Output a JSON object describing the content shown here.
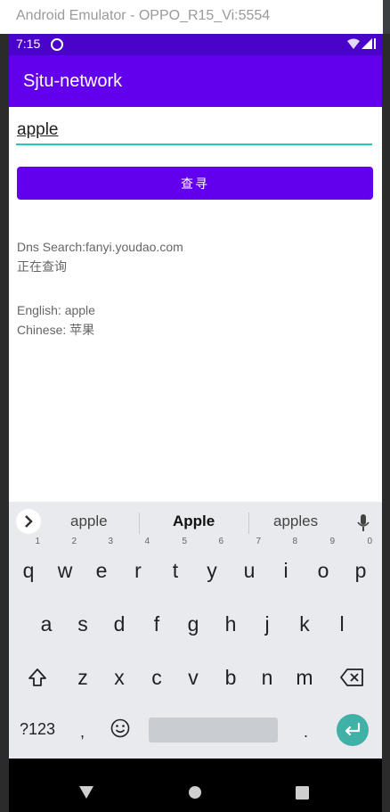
{
  "window": {
    "title": "Android Emulator - OPPO_R15_Vi:5554"
  },
  "status_bar": {
    "time": "7:15"
  },
  "app_bar": {
    "title": "Sjtu-network"
  },
  "search": {
    "value": "apple"
  },
  "query_button": {
    "label": "查寻"
  },
  "result": {
    "dns_line": "Dns Search:fanyi.youdao.com",
    "status_line": "正在查询",
    "english_line": "English: apple",
    "chinese_line": "Chinese: 苹果"
  },
  "keyboard": {
    "suggestions": [
      "apple",
      "Apple",
      "apples"
    ],
    "row1": [
      {
        "key": "q",
        "hint": "1"
      },
      {
        "key": "w",
        "hint": "2"
      },
      {
        "key": "e",
        "hint": "3"
      },
      {
        "key": "r",
        "hint": "4"
      },
      {
        "key": "t",
        "hint": "5"
      },
      {
        "key": "y",
        "hint": "6"
      },
      {
        "key": "u",
        "hint": "7"
      },
      {
        "key": "i",
        "hint": "8"
      },
      {
        "key": "o",
        "hint": "9"
      },
      {
        "key": "p",
        "hint": "0"
      }
    ],
    "row2": [
      "a",
      "s",
      "d",
      "f",
      "g",
      "h",
      "j",
      "k",
      "l"
    ],
    "row3": [
      "z",
      "x",
      "c",
      "v",
      "b",
      "n",
      "m"
    ],
    "symbols_label": "?123",
    "comma_label": ",",
    "period_label": "."
  },
  "icons": [
    "wifi-icon",
    "signal-icon",
    "sync-icon",
    "chevron-right-icon",
    "mic-icon",
    "shift-icon",
    "backspace-icon",
    "emoji-icon",
    "enter-icon",
    "back-icon",
    "home-icon",
    "recents-icon"
  ],
  "colors": {
    "primary": "#6200ee",
    "status_bar": "#4a04c9",
    "accent": "#26c6b6",
    "enter_key": "#3fb1a6"
  }
}
